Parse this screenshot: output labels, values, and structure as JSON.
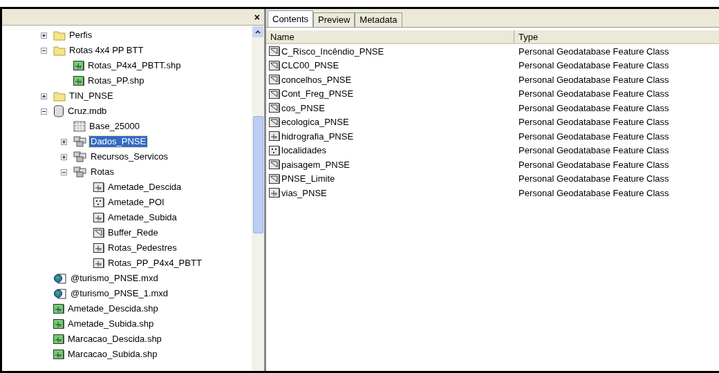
{
  "tree_panel": {
    "close": "×",
    "items": [
      {
        "label": "Perfis",
        "kind": "folder",
        "expanded": false,
        "selected": false
      },
      {
        "label": "Rotas 4x4 PP BTT",
        "kind": "folder",
        "expanded": true,
        "selected": false,
        "children": [
          {
            "label": "Rotas_P4x4_PBTT.shp",
            "kind": "shapefile",
            "selected": false
          },
          {
            "label": "Rotas_PP.shp",
            "kind": "shapefile",
            "selected": false
          }
        ]
      },
      {
        "label": "TIN_PNSE",
        "kind": "folder",
        "expanded": false,
        "selected": false
      },
      {
        "label": "Cruz.mdb",
        "kind": "database",
        "expanded": true,
        "selected": false,
        "children": [
          {
            "label": "Base_25000",
            "kind": "raster",
            "selected": false
          },
          {
            "label": "Dados_PNSE",
            "kind": "dataset",
            "expanded": false,
            "selected": true
          },
          {
            "label": "Recursos_Servicos",
            "kind": "dataset",
            "expanded": false,
            "selected": false
          },
          {
            "label": "Rotas",
            "kind": "dataset",
            "expanded": true,
            "selected": false,
            "children": [
              {
                "label": "Ametade_Descida",
                "kind": "line",
                "selected": false
              },
              {
                "label": "Ametade_POI",
                "kind": "point",
                "selected": false
              },
              {
                "label": "Ametade_Subida",
                "kind": "line",
                "selected": false
              },
              {
                "label": "Buffer_Rede",
                "kind": "polygon",
                "selected": false
              },
              {
                "label": "Rotas_Pedestres",
                "kind": "line",
                "selected": false
              },
              {
                "label": "Rotas_PP_P4x4_PBTT",
                "kind": "line",
                "selected": false
              }
            ]
          }
        ]
      },
      {
        "label": "@turismo_PNSE.mxd",
        "kind": "map",
        "selected": false
      },
      {
        "label": "@turismo_PNSE_1.mxd",
        "kind": "map",
        "selected": false
      },
      {
        "label": "Ametade_Descida.shp",
        "kind": "shapefile",
        "selected": false
      },
      {
        "label": "Ametade_Subida.shp",
        "kind": "shapefile",
        "selected": false
      },
      {
        "label": "Marcacao_Descida.shp",
        "kind": "shapefile",
        "selected": false
      },
      {
        "label": "Marcacao_Subida.shp",
        "kind": "shapefile",
        "selected": false
      }
    ]
  },
  "tabs": [
    {
      "label": "Contents",
      "selected": true
    },
    {
      "label": "Preview",
      "selected": false
    },
    {
      "label": "Metadata",
      "selected": false
    }
  ],
  "table": {
    "columns": [
      "Name",
      "Type"
    ],
    "rows": [
      {
        "name": "C_Risco_Incêndio_PNSE",
        "kind": "polygon",
        "type": "Personal Geodatabase Feature Class"
      },
      {
        "name": "CLC00_PNSE",
        "kind": "polygon",
        "type": "Personal Geodatabase Feature Class"
      },
      {
        "name": "concelhos_PNSE",
        "kind": "polygon",
        "type": "Personal Geodatabase Feature Class"
      },
      {
        "name": "Cont_Freg_PNSE",
        "kind": "polygon",
        "type": "Personal Geodatabase Feature Class"
      },
      {
        "name": "cos_PNSE",
        "kind": "polygon",
        "type": "Personal Geodatabase Feature Class"
      },
      {
        "name": "ecologica_PNSE",
        "kind": "polygon",
        "type": "Personal Geodatabase Feature Class"
      },
      {
        "name": "hidrografia_PNSE",
        "kind": "line",
        "type": "Personal Geodatabase Feature Class"
      },
      {
        "name": "localidades",
        "kind": "point",
        "type": "Personal Geodatabase Feature Class"
      },
      {
        "name": "paisagem_PNSE",
        "kind": "polygon",
        "type": "Personal Geodatabase Feature Class"
      },
      {
        "name": "PNSE_Limite",
        "kind": "polygon",
        "type": "Personal Geodatabase Feature Class"
      },
      {
        "name": "vias_PNSE",
        "kind": "line",
        "type": "Personal Geodatabase Feature Class"
      }
    ]
  }
}
